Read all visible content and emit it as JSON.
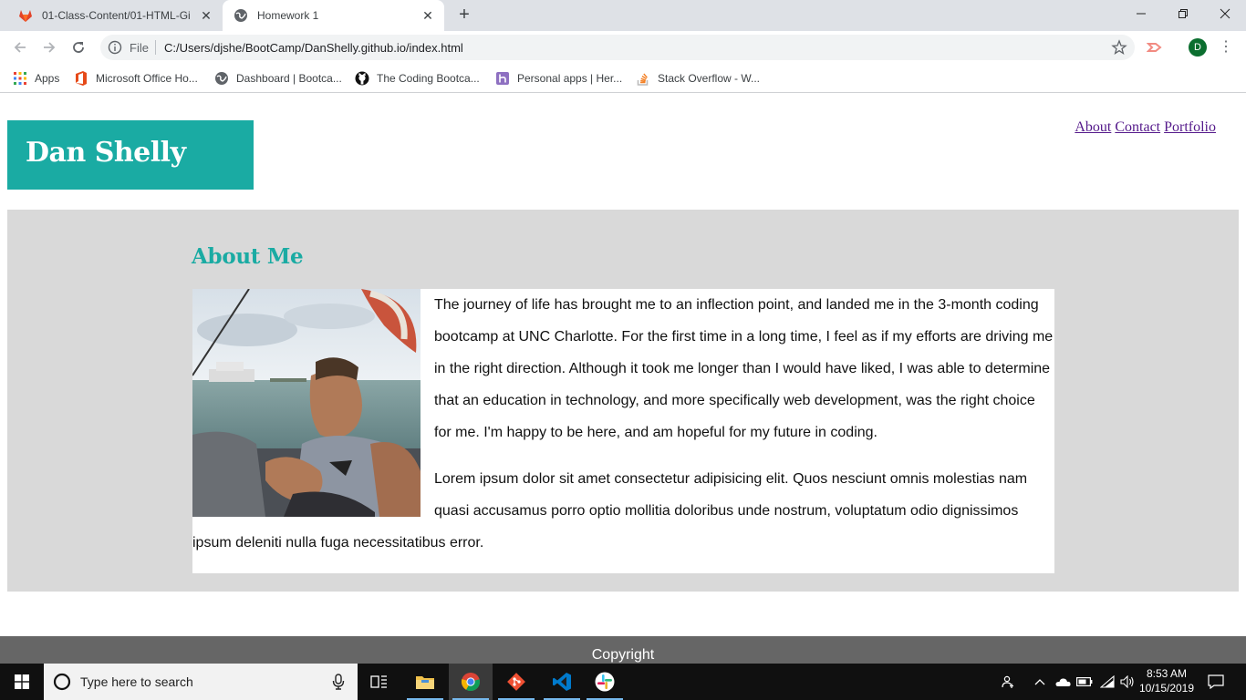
{
  "browser": {
    "tabs": [
      {
        "title": "01-Class-Content/01-HTML-Git-C",
        "icon": "gitlab-icon",
        "active": false
      },
      {
        "title": "Homework 1",
        "icon": "globe-icon",
        "active": true
      }
    ],
    "address": {
      "scheme": "File",
      "url": "C:/Users/djshe/BootCamp/DanShelly.github.io/index.html"
    },
    "profile_initial": "D",
    "bookmarks": [
      {
        "label": "Apps",
        "icon": "apps-grid-icon"
      },
      {
        "label": "Microsoft Office Ho...",
        "icon": "office-icon"
      },
      {
        "label": "Dashboard | Bootca...",
        "icon": "globe-icon"
      },
      {
        "label": "The Coding Bootca...",
        "icon": "github-icon"
      },
      {
        "label": "Personal apps | Her...",
        "icon": "heroku-icon"
      },
      {
        "label": "Stack Overflow - W...",
        "icon": "stackoverflow-icon"
      }
    ]
  },
  "page": {
    "brand": "Dan Shelly",
    "nav": [
      "About",
      "Contact",
      "Portfolio"
    ],
    "about": {
      "heading": "About Me",
      "paragraphs": [
        "The journey of life has brought me to an inflection point, and landed me in the 3-month coding bootcamp at UNC Charlotte. For the first time in a long time, I feel as if my efforts are driving me in the right direction. Although it took me longer than I would have liked, I was able to determine that an education in technology, and more specifically web development, was the right choice for me. I'm happy to be here, and am hopeful for my future in coding.",
        "Lorem ipsum dolor sit amet consectetur adipisicing elit. Quos nesciunt omnis molestias nam quasi accusamus porro optio mollitia doloribus unde nostrum, voluptatum odio dignissimos ipsum deleniti nulla fuga necessitatibus error."
      ]
    },
    "footer": "Copyright"
  },
  "taskbar": {
    "search_placeholder": "Type here to search",
    "clock": {
      "time": "8:53 AM",
      "date": "10/15/2019"
    }
  },
  "colors": {
    "brand_teal": "#1aaba3",
    "band_gray": "#d9d9d9",
    "footer_gray": "#666666",
    "link_visited": "#551a8b"
  }
}
